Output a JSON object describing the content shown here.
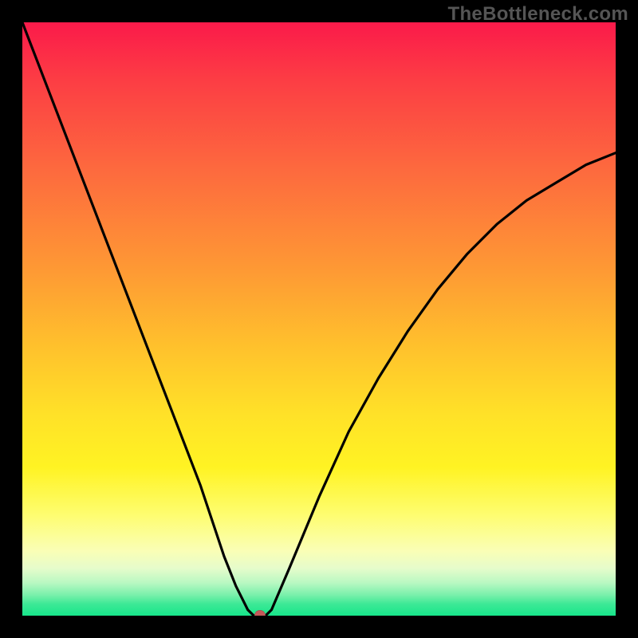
{
  "watermark": "TheBottleneck.com",
  "chart_data": {
    "type": "line",
    "title": "",
    "xlabel": "",
    "ylabel": "",
    "xlim": [
      0,
      100
    ],
    "ylim": [
      0,
      100
    ],
    "grid": false,
    "series": [
      {
        "name": "bottleneck-curve",
        "x": [
          0,
          5,
          10,
          15,
          20,
          25,
          30,
          34,
          36,
          38,
          39,
          40,
          41,
          42,
          45,
          50,
          55,
          60,
          65,
          70,
          75,
          80,
          85,
          90,
          95,
          100
        ],
        "y": [
          100,
          87,
          74,
          61,
          48,
          35,
          22,
          10,
          5,
          1,
          0,
          0,
          0,
          1,
          8,
          20,
          31,
          40,
          48,
          55,
          61,
          66,
          70,
          73,
          76,
          78
        ]
      }
    ],
    "marker": {
      "x": 40,
      "y": 0,
      "color": "#c55a5a"
    },
    "background_gradient": {
      "stops": [
        {
          "pos": 0,
          "color": "#fb1a4a"
        },
        {
          "pos": 0.55,
          "color": "#ffc22c"
        },
        {
          "pos": 0.75,
          "color": "#fff323"
        },
        {
          "pos": 1.0,
          "color": "#17e58b"
        }
      ]
    }
  }
}
